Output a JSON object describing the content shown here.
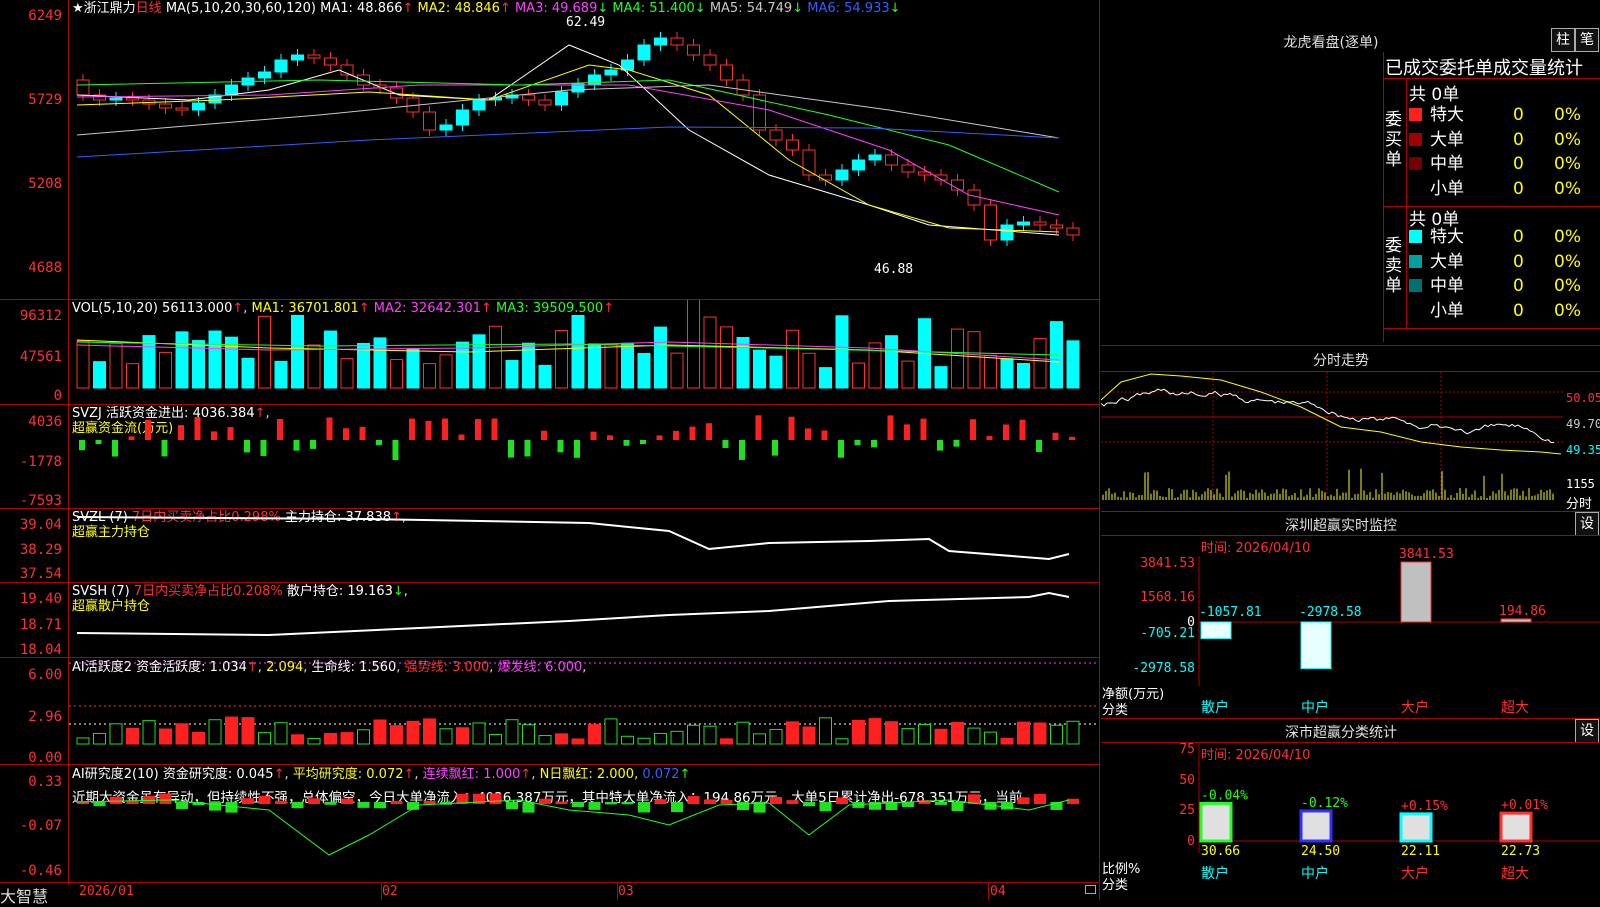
{
  "stock": {
    "name_prefix": "★浙江鼎力",
    "period": "日线"
  },
  "main_panel": {
    "ma_label": "MA(5,10,20,30,60,120)",
    "ma": [
      {
        "label": "MA1:",
        "value": "48.866",
        "dir": "↑",
        "color": "#ffffff"
      },
      {
        "label": "MA2:",
        "value": "48.846",
        "dir": "↑",
        "color": "#ffff00"
      },
      {
        "label": "MA3:",
        "value": "49.689",
        "dir": "↓",
        "color": "#ff40ff"
      },
      {
        "label": "MA4:",
        "value": "51.400",
        "dir": "↓",
        "color": "#20ff20"
      },
      {
        "label": "MA5:",
        "value": "54.749",
        "dir": "↓",
        "color": "#c8c8c8"
      },
      {
        "label": "MA6:",
        "value": "54.933",
        "dir": "↓",
        "color": "#3060ff"
      }
    ],
    "y_ticks": [
      "6249",
      "5729",
      "5208",
      "4688"
    ],
    "high_label": "62.49",
    "low_label": "46.88"
  },
  "vol_panel": {
    "label": "VOL(5,10,20)",
    "value": "56113.000",
    "ma": [
      {
        "label": "MA1:",
        "value": "36701.801",
        "dir": "↑",
        "color": "#ffff00"
      },
      {
        "label": "MA2:",
        "value": "32642.301",
        "dir": "↑",
        "color": "#ff40ff"
      },
      {
        "label": "MA3:",
        "value": "39509.500",
        "dir": "↑",
        "color": "#20ff20"
      }
    ],
    "y_ticks": [
      "96312",
      "47561",
      "0"
    ]
  },
  "svzj_panel": {
    "label": "SVZJ",
    "item": "活跃资金进出:",
    "value": "4036.384",
    "dir": "↑",
    "sub": "超赢资金流(万元)",
    "y_ticks": [
      "4036",
      "-1778",
      "-7593"
    ]
  },
  "svzl_panel": {
    "label": "SVZL (7)",
    "item": "7日内买卖净占比0.298%",
    "item2": "主力持仓:",
    "value": "37.838",
    "dir": "↑",
    "sub": "超赢主力持仓",
    "y_ticks": [
      "39.04",
      "38.29",
      "37.54"
    ]
  },
  "svsh_panel": {
    "label": "SVSH (7)",
    "item": "7日内买卖净占比0.208%",
    "item2": "散户持仓:",
    "value": "19.163",
    "dir": "↓",
    "sub": "超赢散户持仓",
    "y_ticks": [
      "19.40",
      "18.71",
      "18.04"
    ]
  },
  "ai2_panel": {
    "label": "AI活跃度2",
    "item": "资金活跃度:",
    "v1": "1.034",
    "v2": "2.094",
    "item2": "生命线:",
    "v3": "1.560",
    "strong": "强势线: 3.000",
    "burst": "爆发线: 6.000",
    "y_ticks": [
      "6.00",
      "2.96",
      "0.00"
    ]
  },
  "ai_research_panel": {
    "label": "AI研究度2(10)",
    "item": "资金研究度:",
    "v1": "0.045",
    "avg": "平均研究度:",
    "v2": "0.072",
    "cont": "连续飘红:",
    "v3": "1.000",
    "nday": "N日飘红:",
    "v4": "2.000",
    "v5": "0.072",
    "commentary": "近期大资金虽有异动，但持续性不强，总体偏空，今日大单净流入：4036.387万元，其中特大单净流入：194.86万元，大单5日累计净出-678.351万元，当前",
    "y_ticks": [
      "0.33",
      "-0.07",
      "-0.46"
    ]
  },
  "x_axis": {
    "labels": [
      "2026/01",
      "02",
      "03",
      "04"
    ]
  },
  "brand": "大智慧",
  "right": {
    "lhb_title": "龙虎看盘(逐单)",
    "btn1": "柱",
    "btn2": "笔",
    "orders_title": "已成交委托单成交量统计",
    "buy": {
      "side": "委买单",
      "total": "共 0单",
      "rows": [
        {
          "label": "特大",
          "count": "0",
          "pct": "0%",
          "color": "#ff2020"
        },
        {
          "label": "大单",
          "count": "0",
          "pct": "0%",
          "color": "#a00000"
        },
        {
          "label": "中单",
          "count": "0",
          "pct": "0%",
          "color": "#700000"
        },
        {
          "label": "小单",
          "count": "0",
          "pct": "0%",
          "color": ""
        }
      ]
    },
    "sell": {
      "side": "委卖单",
      "total": "共 0单",
      "rows": [
        {
          "label": "特大",
          "count": "0",
          "pct": "0%",
          "color": "#00ffff"
        },
        {
          "label": "大单",
          "count": "0",
          "pct": "0%",
          "color": "#00a0a0"
        },
        {
          "label": "中单",
          "count": "0",
          "pct": "0%",
          "color": "#007070"
        },
        {
          "label": "小单",
          "count": "0",
          "pct": "0%",
          "color": ""
        }
      ]
    },
    "intraday": {
      "title": "分时走势",
      "p1": "50.05",
      "p2": "49.70",
      "p3": "49.35",
      "vol": "1155",
      "vol_label": "分时"
    },
    "monitor": {
      "title": "深圳超赢实时监控",
      "btn": "设",
      "time": "时间: 2026/04/10",
      "y_ticks": [
        "3841.53",
        "1568.16",
        "0",
        "-705.21",
        "-2978.58"
      ],
      "ylabel": "净额(万元)",
      "xlabel": "分类",
      "cats": [
        "散户",
        "中户",
        "大户",
        "超大"
      ],
      "values": [
        "-1057.81",
        "-2978.58",
        "3841.53",
        "194.86"
      ]
    },
    "classify": {
      "title": "深市超赢分类统计",
      "btn": "设",
      "time": "时间: 2026/04/10",
      "y_ticks": [
        "75",
        "50",
        "25",
        "0"
      ],
      "ylabel": "比例%",
      "xlabel": "分类",
      "cats": [
        "散户",
        "中户",
        "大户",
        "超大"
      ],
      "values": [
        "30.66",
        "24.50",
        "22.11",
        "22.73"
      ],
      "changes": [
        "-0.04%",
        "-0.12%",
        "+0.15%",
        "+0.01%"
      ]
    }
  }
}
